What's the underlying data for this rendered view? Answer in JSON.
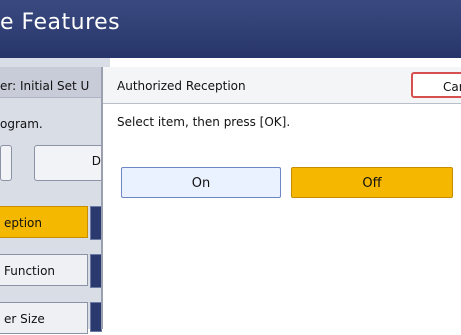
{
  "window": {
    "title": "e Features"
  },
  "background": {
    "tab_text": "er: Initial Set U",
    "program_text": "ogram.",
    "button_d": "D",
    "menu": [
      {
        "label": "eption",
        "selected": true
      },
      {
        "label": "Function",
        "selected": false
      },
      {
        "label": "er Size",
        "selected": false
      }
    ]
  },
  "dialog": {
    "title": "Authorized Reception",
    "cancel_label": "Car",
    "instruction": "Select item, then press [OK].",
    "options": [
      {
        "label": "On",
        "selected": false
      },
      {
        "label": "Off",
        "selected": true
      }
    ]
  },
  "colors": {
    "accent": "#f5b800",
    "titlebar": "#2f3d74",
    "cancel_border": "#d6504f"
  }
}
